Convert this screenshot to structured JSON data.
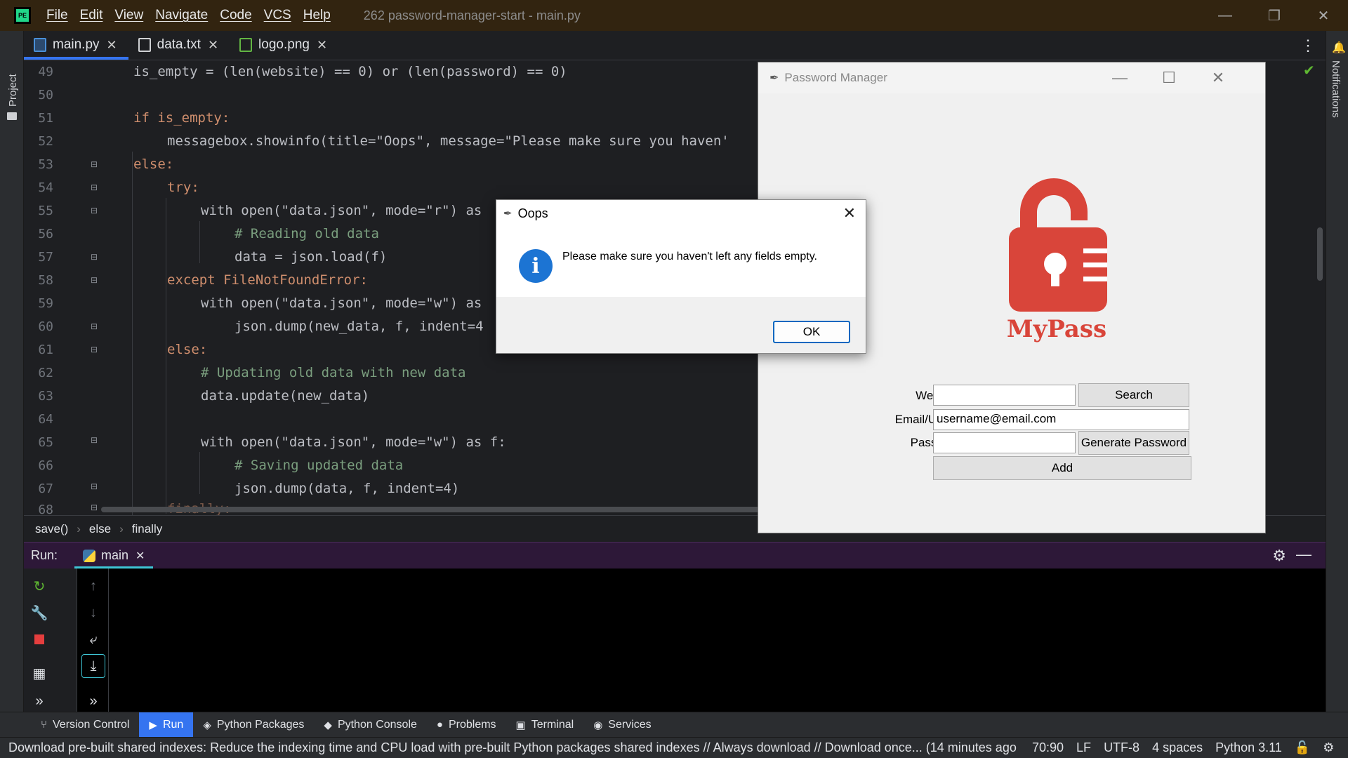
{
  "titlebar": {
    "logo_text": "PE",
    "menu": [
      "File",
      "Edit",
      "View",
      "Navigate",
      "Code",
      "VCS",
      "Help"
    ],
    "window_title": "262 password-manager-start - main.py"
  },
  "left_strip": {
    "project_label": "Project"
  },
  "right_strip": {
    "notifications_label": "Notifications"
  },
  "tabs": [
    {
      "label": "main.py",
      "icon": "python-file-icon"
    },
    {
      "label": "data.txt",
      "icon": "text-file-icon"
    },
    {
      "label": "logo.png",
      "icon": "image-file-icon"
    }
  ],
  "editor": {
    "line_numbers": [
      "49",
      "50",
      "51",
      "52",
      "53",
      "54",
      "55",
      "56",
      "57",
      "58",
      "59",
      "60",
      "61",
      "62",
      "63",
      "64",
      "65",
      "66",
      "67",
      "68"
    ],
    "lines": {
      "l49": "is_empty = (len(website) == 0) or (len(password) == 0)",
      "l51": "if is_empty:",
      "l52": "messagebox.showinfo(title=\"Oops\", message=\"Please make sure you haven'",
      "l53": "else:",
      "l54": "try:",
      "l55": "with open(\"data.json\", mode=\"r\") as",
      "l56": "# Reading old data",
      "l57": "data = json.load(f)",
      "l58": "except FileNotFoundError:",
      "l59": "with open(\"data.json\", mode=\"w\") as",
      "l60": "json.dump(new_data, f, indent=4",
      "l61": "else:",
      "l62": "# Updating old data with new data",
      "l63": "data.update(new_data)",
      "l65": "with open(\"data.json\", mode=\"w\") as f:",
      "l66": "# Saving updated data",
      "l67": "json.dump(data, f, indent=4)",
      "l68": "finally:"
    }
  },
  "breadcrumb": [
    "save()",
    "else",
    "finally"
  ],
  "run_panel": {
    "label": "Run:",
    "tab": "main"
  },
  "tool_windows": [
    "Version Control",
    "Run",
    "Python Packages",
    "Python Console",
    "Problems",
    "Terminal",
    "Services"
  ],
  "statusbar": {
    "message": "Download pre-built shared indexes: Reduce the indexing time and CPU load with pre-built Python packages shared indexes // Always download // Download once... (14 minutes ago",
    "position": "70:90",
    "line_sep": "LF",
    "encoding": "UTF-8",
    "indent": "4 spaces",
    "interpreter": "Python 3.11"
  },
  "password_manager": {
    "title": "Password Manager",
    "logo_text": "MyPass",
    "website_label": "Website:",
    "email_label": "Email/Username:",
    "password_label": "Password:",
    "website_value": "",
    "email_value": "username@email.com",
    "password_value": "",
    "search_button": "Search",
    "generate_button": "Generate Password",
    "add_button": "Add"
  },
  "dialog": {
    "title": "Oops",
    "message": "Please make sure you haven't left any fields empty.",
    "ok_button": "OK"
  },
  "colors": {
    "accent": "#3574f0",
    "run_header": "#2d1838",
    "titlebar": "#322410",
    "logo_red": "#d9453a"
  }
}
